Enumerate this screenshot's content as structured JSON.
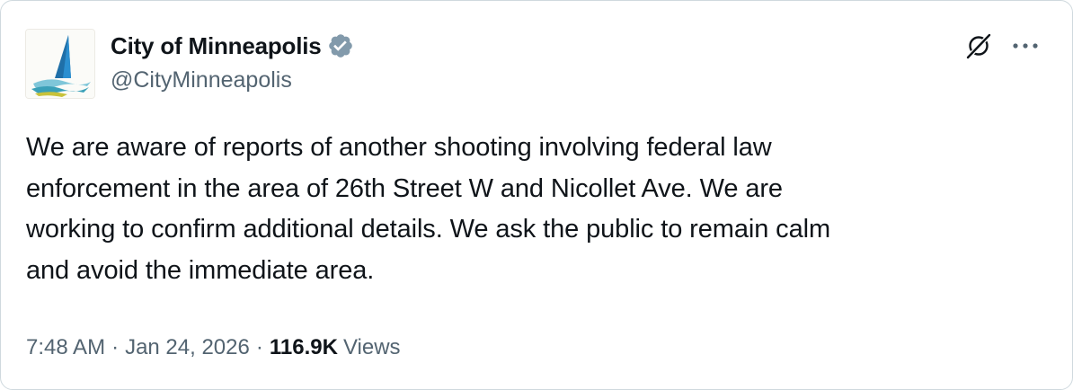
{
  "author": {
    "display_name": "City of Minneapolis",
    "handle": "@CityMinneapolis",
    "verified_badge": "verified-badge",
    "verified_color": "#829aab"
  },
  "header_actions": {
    "grok_icon": "grok-icon",
    "more_icon": "more-options-icon"
  },
  "tweet": {
    "text": "We are aware of reports of another shooting involving federal law\nenforcement in the area of 26th Street W and Nicollet Ave. We are\nworking to confirm additional details. We ask the public to remain calm\nand avoid the immediate area."
  },
  "meta": {
    "time": "7:48 AM",
    "separator": "·",
    "date": "Jan 24, 2026",
    "views_count": "116.9K",
    "views_label": "Views"
  },
  "colors": {
    "text_primary": "#0f1419",
    "text_secondary": "#536471",
    "border": "#cfd9de"
  }
}
